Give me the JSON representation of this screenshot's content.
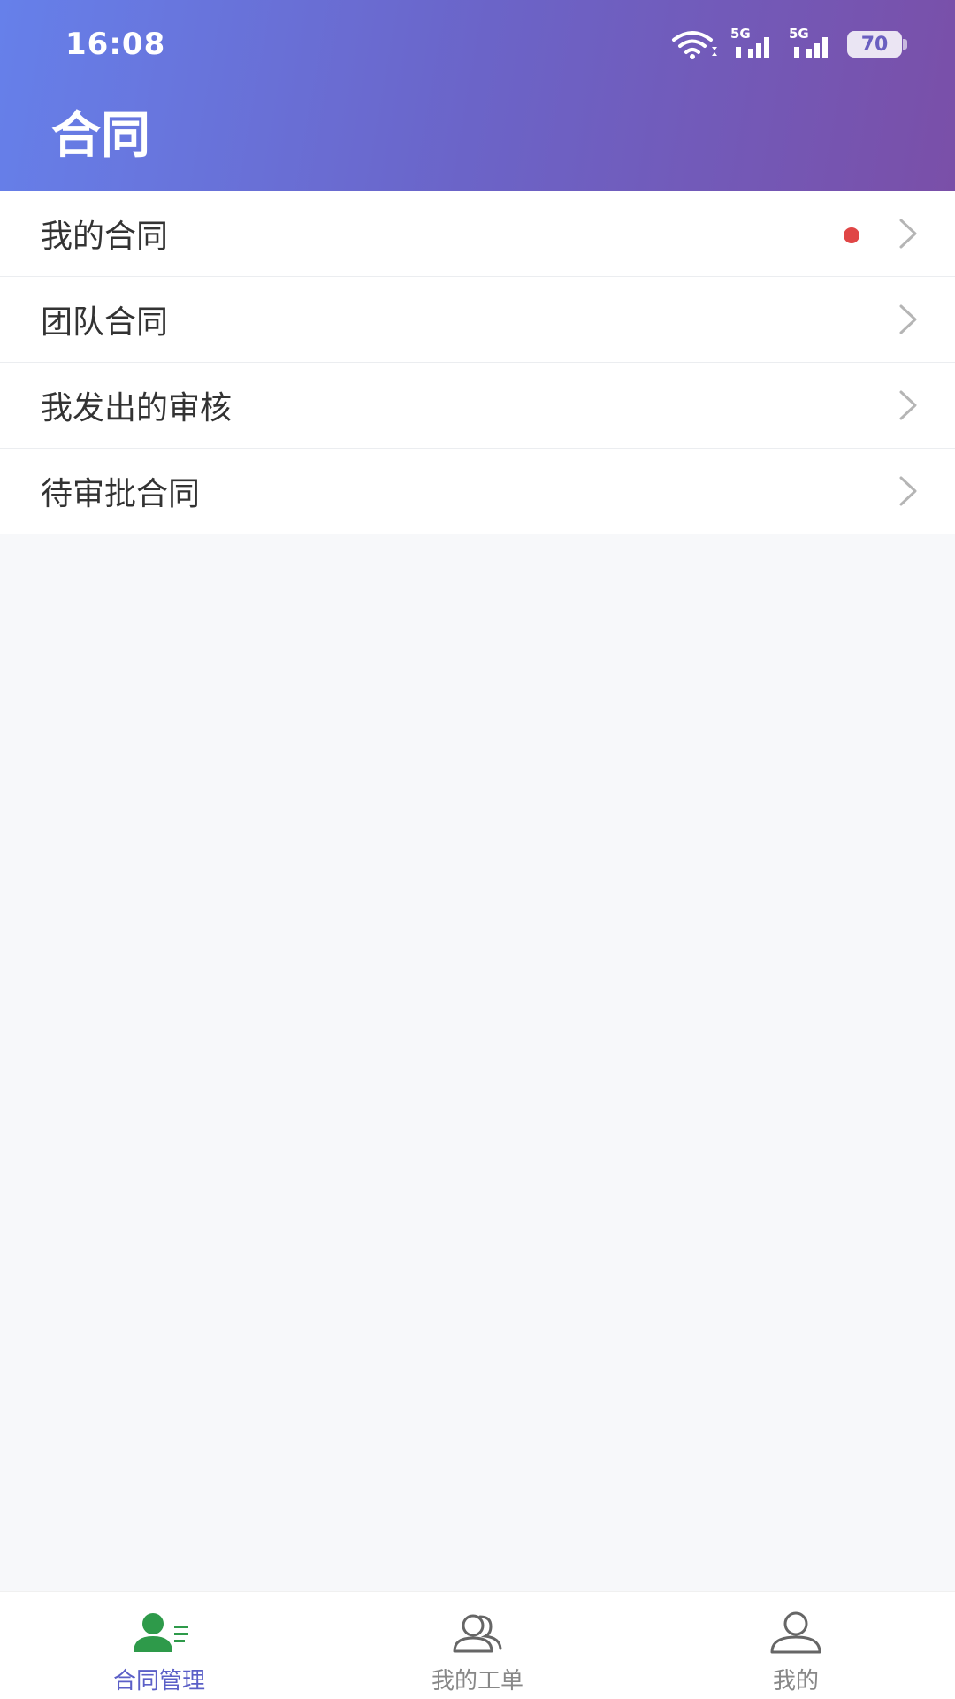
{
  "status_bar": {
    "time": "16:08",
    "network_1": "5G",
    "network_2": "5G",
    "battery": "70"
  },
  "header": {
    "title": "合同"
  },
  "menu": {
    "items": [
      {
        "label": "我的合同",
        "has_dot": true
      },
      {
        "label": "团队合同",
        "has_dot": false
      },
      {
        "label": "我发出的审核",
        "has_dot": false
      },
      {
        "label": "待审批合同",
        "has_dot": false
      }
    ]
  },
  "tabs": [
    {
      "label": "合同管理",
      "icon": "contract-manage-icon",
      "active": true
    },
    {
      "label": "我的工单",
      "icon": "work-order-icon",
      "active": false
    },
    {
      "label": "我的",
      "icon": "profile-icon",
      "active": false
    }
  ],
  "colors": {
    "header_gradient_start": "#6680ea",
    "header_gradient_end": "#7a4fa8",
    "active_tab_icon": "#2e9a4a",
    "active_tab_text": "#5b5fc7",
    "badge_dot": "#e04646"
  }
}
